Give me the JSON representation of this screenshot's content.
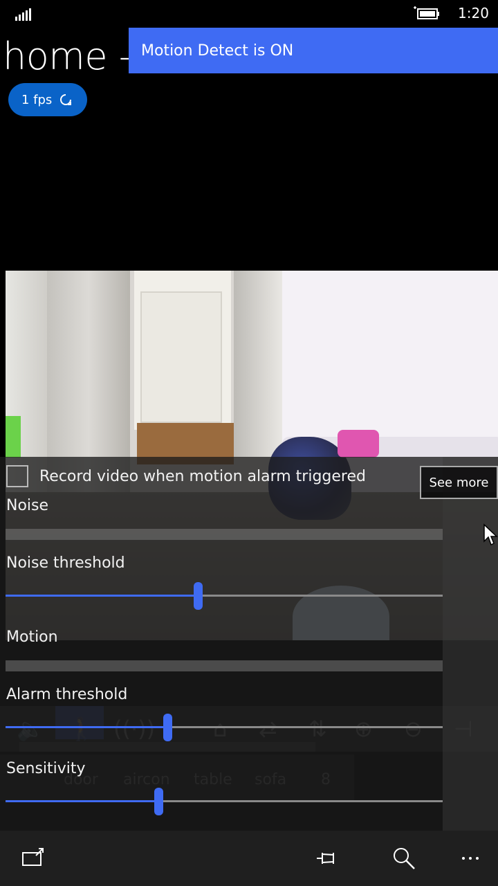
{
  "status_bar": {
    "time": "1:20"
  },
  "title": "home -",
  "fps_button": {
    "label": "1 fps"
  },
  "toast": {
    "text": "Motion Detect is ON"
  },
  "settings": {
    "record_checkbox": {
      "label": "Record video when motion alarm triggered",
      "checked": false
    },
    "see_more": "See more",
    "noise_label": "Noise",
    "noise_threshold_label": "Noise threshold",
    "noise_threshold_value": 0.44,
    "motion_label": "Motion",
    "alarm_threshold_label": "Alarm threshold",
    "alarm_threshold_value": 0.37,
    "sensitivity_label": "Sensitivity",
    "sensitivity_value": 0.35
  },
  "background_toolbar": {
    "icons": [
      "volume-icon",
      "walking-person-icon",
      "broadcast-icon",
      "up-arrow-icon",
      "home-icon",
      "swap-icon",
      "sort-icon",
      "zoom-in-icon",
      "zoom-out-icon",
      "pin-icon"
    ],
    "tags": [
      "door",
      "aircon",
      "table",
      "sofa",
      "8"
    ]
  },
  "app_bar": {
    "icons": [
      "select-icon",
      "pin-icon",
      "search-icon",
      "more-icon"
    ]
  },
  "colors": {
    "accent": "#3f6bf3",
    "fps_button": "#0a63c8",
    "app_bar": "#1f1f1f"
  }
}
